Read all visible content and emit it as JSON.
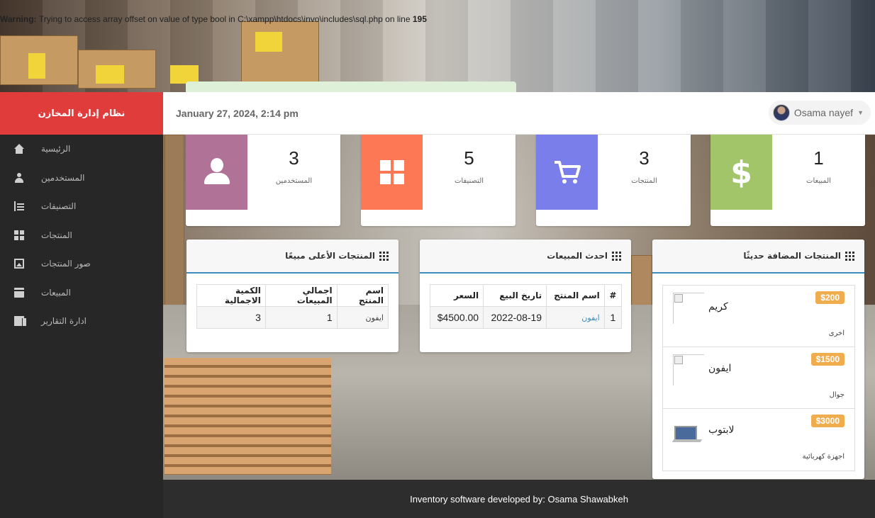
{
  "warning": {
    "prefix": "Warning: ",
    "middle": "Trying to access array offset on value of type bool in C:\\xampp\\htdocs\\invo\\includes\\sql.php",
    "suffix": " on line ",
    "line": "195"
  },
  "header": {
    "app_title": "نظام إدارة المخازن",
    "datetime": "January 27, 2024, 2:14 pm",
    "user_name": "Osama nayef"
  },
  "sidebar": {
    "items": [
      {
        "label": "الرئيسية",
        "icon": "home-icon"
      },
      {
        "label": "المستخدمين",
        "icon": "user-icon"
      },
      {
        "label": "التصنيفات",
        "icon": "tree-icon"
      },
      {
        "label": "المنتجات",
        "icon": "grid-icon"
      },
      {
        "label": "صور المنتجات",
        "icon": "image-icon"
      },
      {
        "label": "المبيعات",
        "icon": "credit-card-icon"
      },
      {
        "label": "ادارة التقارير",
        "icon": "report-icon"
      }
    ]
  },
  "stats": [
    {
      "value": "3",
      "label": "المستخدمين",
      "color": "#b07297",
      "icon": "user-icon"
    },
    {
      "value": "5",
      "label": "التصنيفات",
      "color": "#fd7855",
      "icon": "grid-icon"
    },
    {
      "value": "3",
      "label": "المنتجات",
      "color": "#7a7eeb",
      "icon": "cart-icon"
    },
    {
      "value": "1",
      "label": "المبيعات",
      "color": "#a2c56a",
      "icon": "dollar-icon"
    }
  ],
  "top_selling": {
    "title": "المنتجات الأعلى مبيعًا",
    "headers": [
      "اسم المنتج",
      "اجمالي المبيعات",
      "الكمية الاجمالية"
    ],
    "rows": [
      [
        "ايفون",
        "1",
        "3"
      ]
    ]
  },
  "latest_sales": {
    "title": "احدث المبيعات",
    "headers": [
      "#",
      "اسم المنتج",
      "تاريخ البيع",
      "السعر"
    ],
    "rows": [
      [
        "1",
        "ايفون",
        "2022-08-19",
        "$4500.00"
      ]
    ]
  },
  "recent_products": {
    "title": "المنتجات المضافة حديثًا",
    "items": [
      {
        "name": "كريم",
        "price": "$200",
        "category": "اخرى"
      },
      {
        "name": "ايفون",
        "price": "$1500",
        "category": "جوال"
      },
      {
        "name": "لابتوب",
        "price": "$3000",
        "category": "اجهزة كهربائية"
      }
    ]
  },
  "footer": {
    "text": "Inventory software developed by: Osama Shawabkeh"
  }
}
